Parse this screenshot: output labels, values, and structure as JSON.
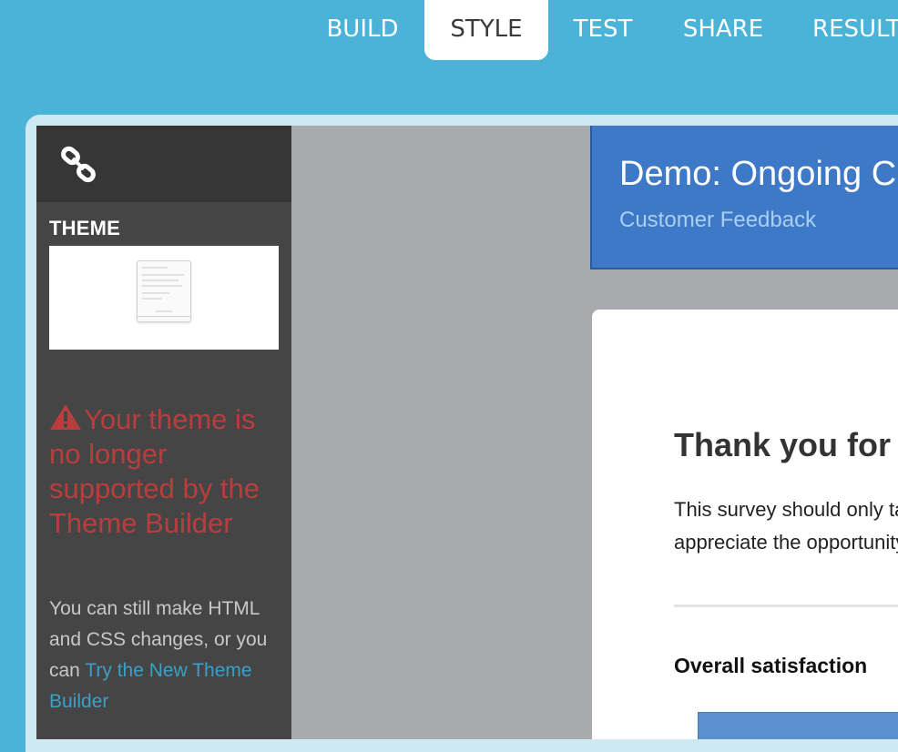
{
  "nav": {
    "tabs": [
      {
        "label": "BUILD",
        "active": false
      },
      {
        "label": "STYLE",
        "active": true
      },
      {
        "label": "TEST",
        "active": false
      },
      {
        "label": "SHARE",
        "active": false
      },
      {
        "label": "RESULTS",
        "active": false
      }
    ]
  },
  "sidebar": {
    "link_icon": "link-icon",
    "theme_label": "THEME",
    "warning_icon": "warning-triangle-icon",
    "warning_text": "Your theme is no longer supported by the Theme Builder",
    "info_text": "You can still make HTML and CSS changes, or you can ",
    "info_link": "Try the New Theme Builder"
  },
  "survey": {
    "title": "Demo: Ongoing Customer Feedback",
    "subtitle": "Customer Feedback",
    "thanks_heading": "Thank you for your time",
    "intro_line1": "This survey should only take a few minutes. We",
    "intro_line2": "appreciate the opportunity to hear from you.",
    "question_label": "Overall satisfaction"
  },
  "colors": {
    "page_bg": "#4bb3d7",
    "sidebar_bg": "#454545",
    "warning": "#b93d3d",
    "link": "#3aa0c8",
    "header_bg": "#3e79c8",
    "canvas_bg": "#a8aaad"
  }
}
